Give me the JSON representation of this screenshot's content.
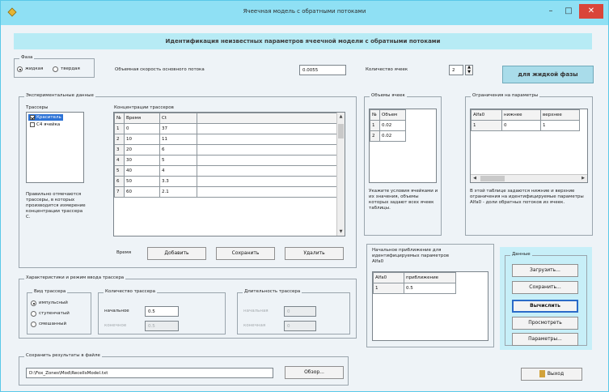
{
  "window": {
    "title": "Ячеечная модель с обратными потоками",
    "minimize_label": "–",
    "maximize_label": "□",
    "close_label": "✕"
  },
  "banner": "Идентификация неизвестных параметров ячеечной модели с обратными потоками",
  "phase": {
    "legend": "Фаза",
    "options": [
      "жидкая",
      "твердая"
    ],
    "selected": "жидкая"
  },
  "flow": {
    "label": "Объемная скорость основного потока",
    "value": "0.0055"
  },
  "cells": {
    "label": "Количество ячеек",
    "value": "2"
  },
  "liquid_phase_button": "для жидкой фазы",
  "experimental": {
    "legend": "Экспериментальные данные",
    "tracer_legend": "Трассеры",
    "tracers": [
      {
        "label": "Краситель",
        "checked": true,
        "selected": true
      },
      {
        "label": "С4 ячейка",
        "checked": false,
        "selected": false
      }
    ],
    "note": "Правильно отмечаются трассеры, в которых производится измерение концентрации трассера С.",
    "table_title": "Концентрации трассеров",
    "columns": [
      "№",
      "Время",
      "Сt"
    ],
    "rows": [
      [
        "1",
        "0",
        "37"
      ],
      [
        "2",
        "10",
        "11"
      ],
      [
        "3",
        "20",
        "6"
      ],
      [
        "4",
        "30",
        "5"
      ],
      [
        "5",
        "40",
        "4"
      ],
      [
        "6",
        "50",
        "3.3"
      ],
      [
        "7",
        "60",
        "2.1"
      ]
    ],
    "time_label": "Время",
    "add_button": "Добавить",
    "save_button": "Сохранить",
    "delete_button": "Удалить"
  },
  "volumes": {
    "legend": "Объемы ячеек",
    "columns": [
      "№",
      "Объем"
    ],
    "rows": [
      [
        "1",
        "0.02"
      ],
      [
        "2",
        "0.02"
      ]
    ],
    "note": "Укажите условия ячейками и их значения, объемы которых задают всех ячеек таблицы."
  },
  "limits": {
    "legend": "Ограничения на параметры",
    "columns": [
      "Alfa0",
      "нижнее",
      "верхнее"
    ],
    "rows": [
      [
        "1",
        "0",
        "1"
      ]
    ],
    "note": "В этой таблице задаются нижние и верхние ограничения на идентифицируемые параметры Alfa0 - доли обратных потоков из ячеек."
  },
  "tracer_props": {
    "legend": "Характеристики и режим ввода трассера",
    "type_legend": "Вид трассера",
    "types": [
      "импульсный",
      "ступенчатый",
      "смешанный"
    ],
    "selected_type": "импульсный",
    "quantity_legend": "Количество трассера",
    "initial_label": "начальное",
    "initial_value": "0.5",
    "final_label": "конечное",
    "final_value": "0.5",
    "duration_legend": "Длительность трассера",
    "start_label": "начальная",
    "start_value": "0",
    "end_label": "конечная",
    "end_value": "0"
  },
  "approx": {
    "legend": "Начальное приближение для идентифицируемых параметров Alfa0",
    "columns": [
      "Alfa0",
      "приближение"
    ],
    "rows": [
      [
        "1",
        "0.5"
      ]
    ]
  },
  "data_panel": {
    "legend": "Данные",
    "load": "Загрузить...",
    "save": "Сохранить...",
    "compute": "Вычислить",
    "view": "Просмотреть",
    "params": "Параметры..."
  },
  "save_results": {
    "legend": "Сохранить результаты в файле",
    "path": "D:\\Fox_Zones\\Mod\\RecellsModel.txt",
    "browse": "Обзор..."
  },
  "exit_button": "Выход"
}
